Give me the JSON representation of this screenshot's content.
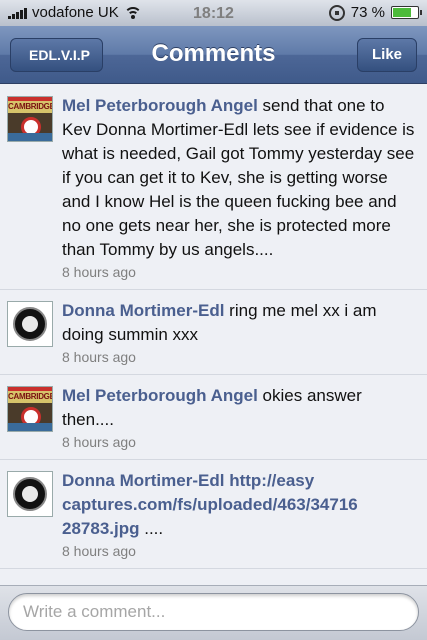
{
  "status_bar": {
    "carrier": "vodafone UK",
    "time": "18:12",
    "battery": "73 %",
    "battery_level": 0.73
  },
  "nav": {
    "back_label": "EDL.V.I.P",
    "title": "Comments",
    "like_label": "Like"
  },
  "comments": [
    {
      "author": "Mel Peterborough Angel",
      "text": " send that one to Kev Donna Mortimer-Edl lets see if evidence is what is needed, Gail got Tommy yesterday see if you can get it to Kev, she is getting worse and I know Hel is the queen fucking bee and no one gets near her, she is protected more than Tommy by us angels....",
      "time": "8 hours ago",
      "avatar_label": "CAMBRIDGE"
    },
    {
      "author": "Donna Mortimer-Edl",
      "text": " ring me mel xx i am doing summin xxx",
      "time": "8 hours ago"
    },
    {
      "author": "Mel Peterborough Angel",
      "text": " okies answer then....",
      "time": "8 hours ago",
      "avatar_label": "CAMBRIDGE"
    },
    {
      "author": "Donna Mortimer-Edl",
      "link": "http://easy captures.com/fs/uploaded/463/34716 28783.jpg",
      "text": " ....",
      "time": "8 hours ago"
    }
  ],
  "composer": {
    "placeholder": "Write a comment..."
  }
}
